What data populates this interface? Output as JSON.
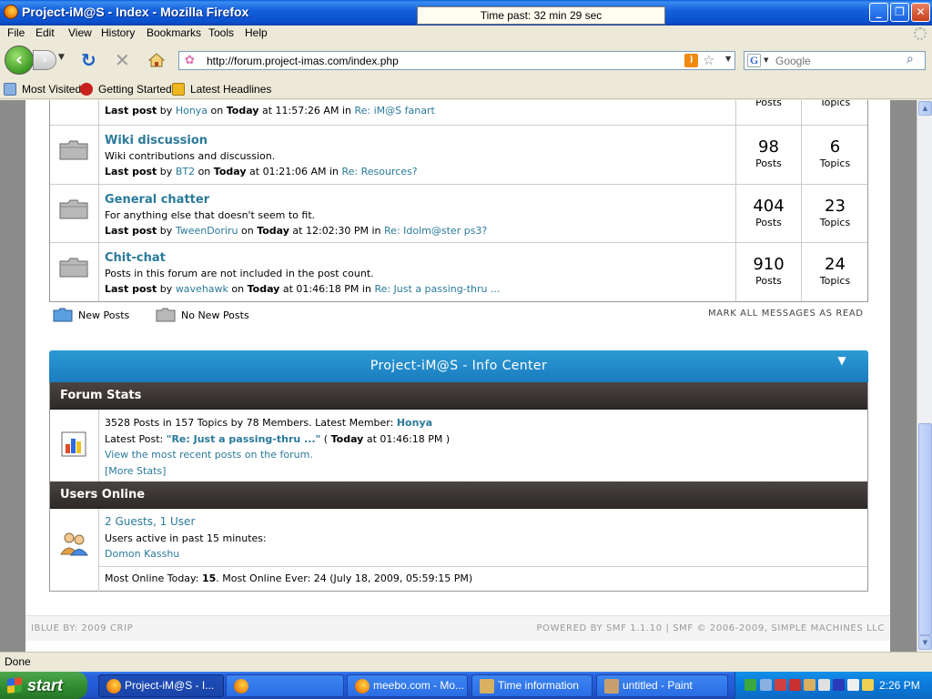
{
  "window": {
    "title": "Project-iM@S - Index - Mozilla Firefox",
    "timer_text": "Time past: 32 min 29 sec"
  },
  "menu": [
    "File",
    "Edit",
    "View",
    "History",
    "Bookmarks",
    "Tools",
    "Help"
  ],
  "navigation": {
    "url": "http://forum.project-imas.com/index.php",
    "search_placeholder": "Google"
  },
  "bookmarks": [
    "Most Visited",
    "Getting Started",
    "Latest Headlines"
  ],
  "boards": [
    {
      "partial": true,
      "lastpost_by": "Honya",
      "lastpost_when": "Today",
      "lastpost_time": " at 11:57:26 AM in ",
      "lastpost_subject": "Re: iM@S fanart",
      "posts_label": "Posts",
      "topics_label": "Topics"
    },
    {
      "name": "Wiki discussion",
      "description": "Wiki contributions and discussion.",
      "lastpost_by": "BT2",
      "lastpost_when": "Today",
      "lastpost_time": " at 01:21:06 AM in ",
      "lastpost_subject": "Re: Resources?",
      "posts": "98",
      "topics": "6",
      "posts_label": "Posts",
      "topics_label": "Topics"
    },
    {
      "name": "General chatter",
      "description": "For anything else that doesn't seem to fit.",
      "lastpost_by": "TweenDoriru",
      "lastpost_when": "Today",
      "lastpost_time": " at 12:02:30 PM in ",
      "lastpost_subject": "Re: Idolm@ster ps3?",
      "posts": "404",
      "topics": "23",
      "posts_label": "Posts",
      "topics_label": "Topics"
    },
    {
      "name": "Chit-chat",
      "description": "Posts in this forum are not included in the post count.",
      "lastpost_by": "wavehawk",
      "lastpost_when": "Today",
      "lastpost_time": " at 01:46:18 PM in ",
      "lastpost_subject": "Re: Just a passing-thru ...",
      "posts": "910",
      "topics": "24",
      "posts_label": "Posts",
      "topics_label": "Topics"
    }
  ],
  "labels": {
    "last_post": "Last post",
    "by": " by ",
    "on": " on "
  },
  "legend": {
    "new_posts": "New Posts",
    "no_new_posts": "No New Posts",
    "mark_all_read": "MARK ALL MESSAGES AS READ"
  },
  "info_center": {
    "title": "Project-iM@S - Info Center",
    "forum_stats": {
      "heading": "Forum Stats",
      "summary": "3528 Posts in 157 Topics by 78 Members. Latest Member: ",
      "latest_member": "Honya",
      "latest_post_label": "Latest Post: ",
      "latest_post_subject": "\"Re: Just a passing-thru ...\"",
      "latest_post_open": " ( ",
      "latest_post_when": "Today",
      "latest_post_time": " at 01:46:18 PM )",
      "recent_link": "View the most recent posts on the forum.",
      "more_stats": "[More Stats]"
    },
    "users_online": {
      "heading": "Users Online",
      "count_link": "2 Guests, 1 User",
      "active_text": "Users active in past 15 minutes:",
      "user": "Domon Kasshu",
      "most_online_prefix": "Most Online Today: ",
      "most_online_today": "15",
      "most_online_rest": ". Most Online Ever: 24 (July 18, 2009, 05:59:15 PM)"
    }
  },
  "page_footer": {
    "left": "IBLUE BY: 2009 CRIP",
    "right": "POWERED BY SMF 1.1.10 | SMF © 2006-2009, SIMPLE MACHINES LLC"
  },
  "status": "Done",
  "taskbar": {
    "start_label": "start",
    "tasks": [
      "Project-iM@S - I...",
      "",
      "meebo.com - Mo...",
      "Time information",
      "untitled - Paint"
    ],
    "clock": "2:26 PM"
  }
}
